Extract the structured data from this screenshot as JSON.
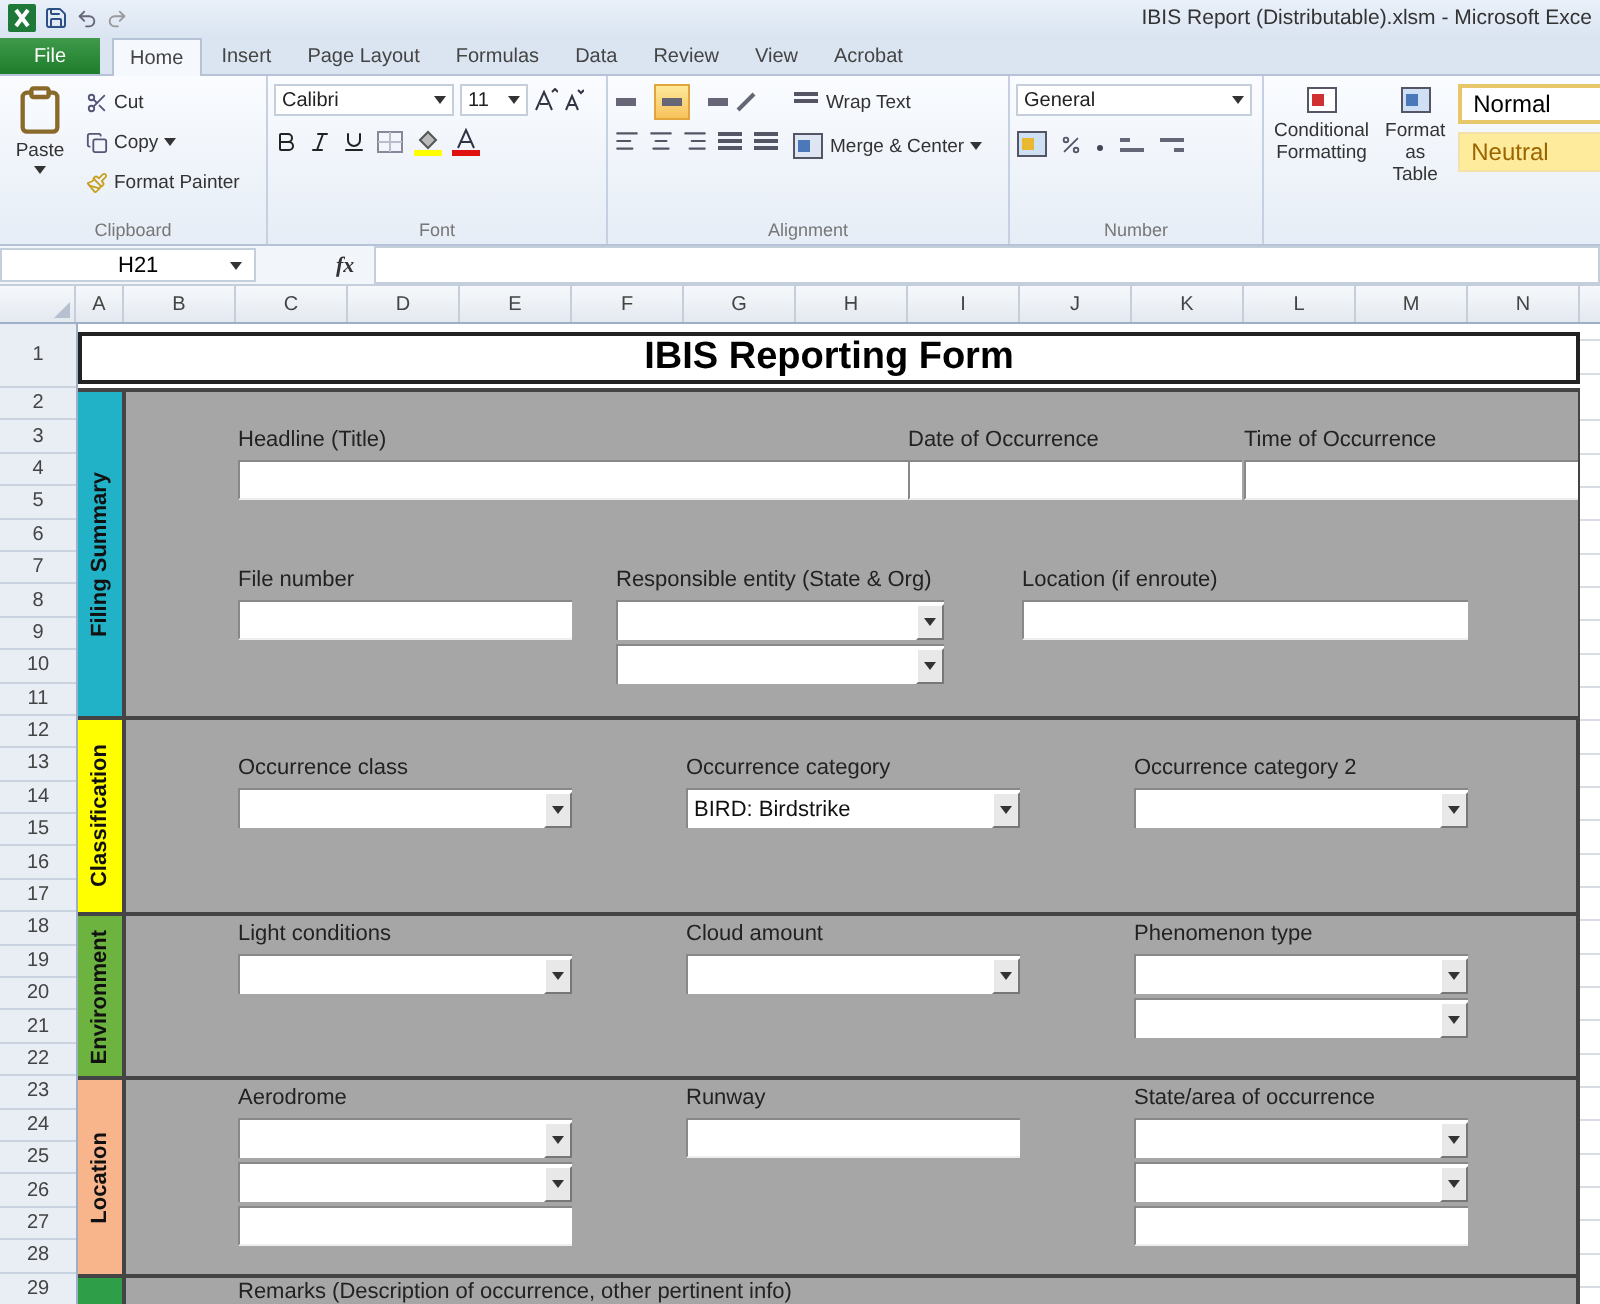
{
  "window": {
    "title": "IBIS Report (Distributable).xlsm - Microsoft Exce"
  },
  "ribbon_tabs": [
    {
      "label": "File",
      "kind": "file",
      "selected": false
    },
    {
      "label": "Home",
      "kind": "tab",
      "selected": true
    },
    {
      "label": "Insert",
      "kind": "tab",
      "selected": false
    },
    {
      "label": "Page Layout",
      "kind": "tab",
      "selected": false
    },
    {
      "label": "Formulas",
      "kind": "tab",
      "selected": false
    },
    {
      "label": "Data",
      "kind": "tab",
      "selected": false
    },
    {
      "label": "Review",
      "kind": "tab",
      "selected": false
    },
    {
      "label": "View",
      "kind": "tab",
      "selected": false
    },
    {
      "label": "Acrobat",
      "kind": "tab",
      "selected": false
    }
  ],
  "ribbon": {
    "clipboard": {
      "paste": "Paste",
      "cut": "Cut",
      "copy": "Copy",
      "format_painter": "Format Painter",
      "label": "Clipboard"
    },
    "font": {
      "name": "Calibri",
      "size": "11",
      "label": "Font"
    },
    "alignment": {
      "vertical": [
        {
          "selected": false
        },
        {
          "selected": true
        },
        {
          "selected": false
        }
      ],
      "wrap_text": "Wrap Text",
      "merge_center": "Merge & Center",
      "label": "Alignment"
    },
    "number": {
      "format": "General",
      "label": "Number"
    },
    "styles": {
      "conditional_formatting": "Conditional Formatting",
      "format_as_table": "Format as Table",
      "cell_styles": [
        {
          "label": "Normal",
          "kind": "normal"
        },
        {
          "label": "Neutral",
          "kind": "neutral"
        }
      ]
    }
  },
  "formula_bar": {
    "cell": "H21",
    "function_label": "fx"
  },
  "sheet": {
    "columns": [
      "A",
      "B",
      "C",
      "D",
      "E",
      "F",
      "G",
      "H",
      "I",
      "J",
      "K",
      "L",
      "M",
      "N"
    ],
    "rows": [
      "1",
      "2",
      "3",
      "4",
      "5",
      "6",
      "7",
      "8",
      "9",
      "10",
      "11",
      "12",
      "13",
      "14",
      "15",
      "16",
      "17",
      "18",
      "19",
      "20",
      "21",
      "22",
      "23",
      "24",
      "25",
      "26",
      "27",
      "28",
      "29"
    ],
    "title": "IBIS Reporting Form",
    "sections": [
      {
        "label": "Filing Summary",
        "color": "#22b2c8",
        "lines": [
          [
            {
              "label": "Headline (Title)",
              "fields": [
                {
                  "kind": "text"
                }
              ]
            },
            {
              "label": "Date of Occurrence",
              "fields": [
                {
                  "kind": "text"
                }
              ]
            },
            {
              "label": "Time of Occurrence",
              "fields": [
                {
                  "kind": "text"
                }
              ]
            }
          ],
          [
            {
              "label": "File number",
              "fields": [
                {
                  "kind": "text"
                }
              ]
            },
            {
              "label": "Responsible entity (State & Org)",
              "fields": [
                {
                  "kind": "dropdown"
                },
                {
                  "kind": "dropdown"
                }
              ]
            },
            {
              "label": "Location (if enroute)",
              "fields": [
                {
                  "kind": "text"
                }
              ]
            }
          ]
        ]
      },
      {
        "label": "Classification",
        "color": "#ffff00",
        "lines": [
          [
            {
              "label": "Occurrence class",
              "fields": [
                {
                  "kind": "dropdown"
                }
              ]
            },
            {
              "label": "Occurrence category",
              "fields": [
                {
                  "kind": "dropdown",
                  "value": "BIRD: Birdstrike"
                }
              ]
            },
            {
              "label": "Occurrence category 2",
              "fields": [
                {
                  "kind": "dropdown"
                }
              ]
            }
          ]
        ]
      },
      {
        "label": "Environment",
        "color": "#6cb33f",
        "lines": [
          [
            {
              "label": "Light conditions",
              "fields": [
                {
                  "kind": "dropdown"
                }
              ]
            },
            {
              "label": "Cloud amount",
              "fields": [
                {
                  "kind": "dropdown"
                }
              ]
            },
            {
              "label": "Phenomenon type",
              "fields": [
                {
                  "kind": "dropdown"
                },
                {
                  "kind": "dropdown"
                }
              ]
            }
          ]
        ]
      },
      {
        "label": "Location",
        "color": "#f8b58c",
        "lines": [
          [
            {
              "label": "Aerodrome",
              "fields": [
                {
                  "kind": "dropdown"
                },
                {
                  "kind": "dropdown"
                },
                {
                  "kind": "text"
                }
              ]
            },
            {
              "label": "Runway",
              "fields": [
                {
                  "kind": "text"
                }
              ]
            },
            {
              "label": "State/area of occurrence",
              "fields": [
                {
                  "kind": "dropdown"
                },
                {
                  "kind": "dropdown"
                },
                {
                  "kind": "text"
                }
              ]
            }
          ]
        ]
      },
      {
        "color": "#2e9e48",
        "lines": [
          [
            {
              "label": "Remarks (Description of occurrence, other pertinent info)"
            }
          ]
        ]
      }
    ]
  }
}
